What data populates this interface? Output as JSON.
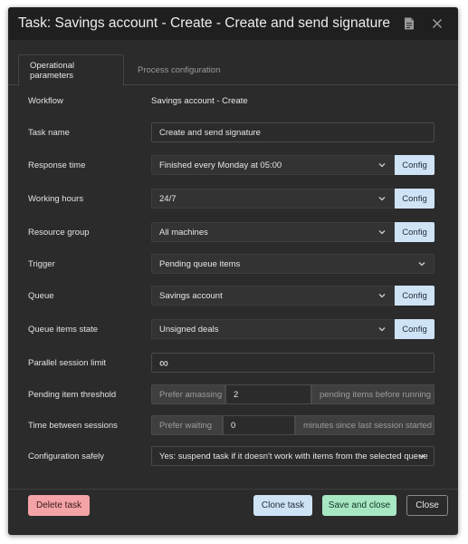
{
  "dialog": {
    "title": "Task: Savings account - Create - Create and send signature",
    "icons": [
      "document-icon",
      "close-icon"
    ]
  },
  "tabs": [
    {
      "label": "Operational parameters",
      "active": true
    },
    {
      "label": "Process configuration",
      "active": false
    }
  ],
  "form": {
    "workflow": {
      "label": "Workflow",
      "value": "Savings account - Create"
    },
    "task_name": {
      "label": "Task name",
      "value": "Create and send signature"
    },
    "response_time": {
      "label": "Response time",
      "value": "Finished every Monday at 05:00",
      "config": "Config"
    },
    "working_hours": {
      "label": "Working hours",
      "value": "24/7",
      "config": "Config"
    },
    "resource_group": {
      "label": "Resource group",
      "value": "All machines",
      "config": "Config"
    },
    "trigger": {
      "label": "Trigger",
      "value": "Pending queue items"
    },
    "queue": {
      "label": "Queue",
      "value": "Savings account",
      "config": "Config"
    },
    "queue_items_state": {
      "label": "Queue items state",
      "value": "Unsigned deals",
      "config": "Config"
    },
    "parallel_session_limit": {
      "label": "Parallel session limit",
      "value": "∞"
    },
    "pending_item_threshold": {
      "label": "Pending item threshold",
      "prefix": "Prefer amassing",
      "value": "2",
      "suffix": "pending items before running"
    },
    "time_between_sessions": {
      "label": "Time between sessions",
      "prefix": "Prefer waiting",
      "value": "0",
      "suffix": "minutes since last session started"
    },
    "configuration_safely": {
      "label": "Configuration safely",
      "value": "Yes: suspend task if it doesn't work with items from the selected queue"
    }
  },
  "footer": {
    "delete": "Delete task",
    "clone": "Clone task",
    "save": "Save and close",
    "close": "Close"
  },
  "colors": {
    "dialog_bg": "#2b2b2b",
    "titlebar_bg": "#1f1f1f",
    "config_button": "#cfe3f6",
    "delete_button": "#f4a3a6",
    "save_button": "#a7e8c3"
  }
}
